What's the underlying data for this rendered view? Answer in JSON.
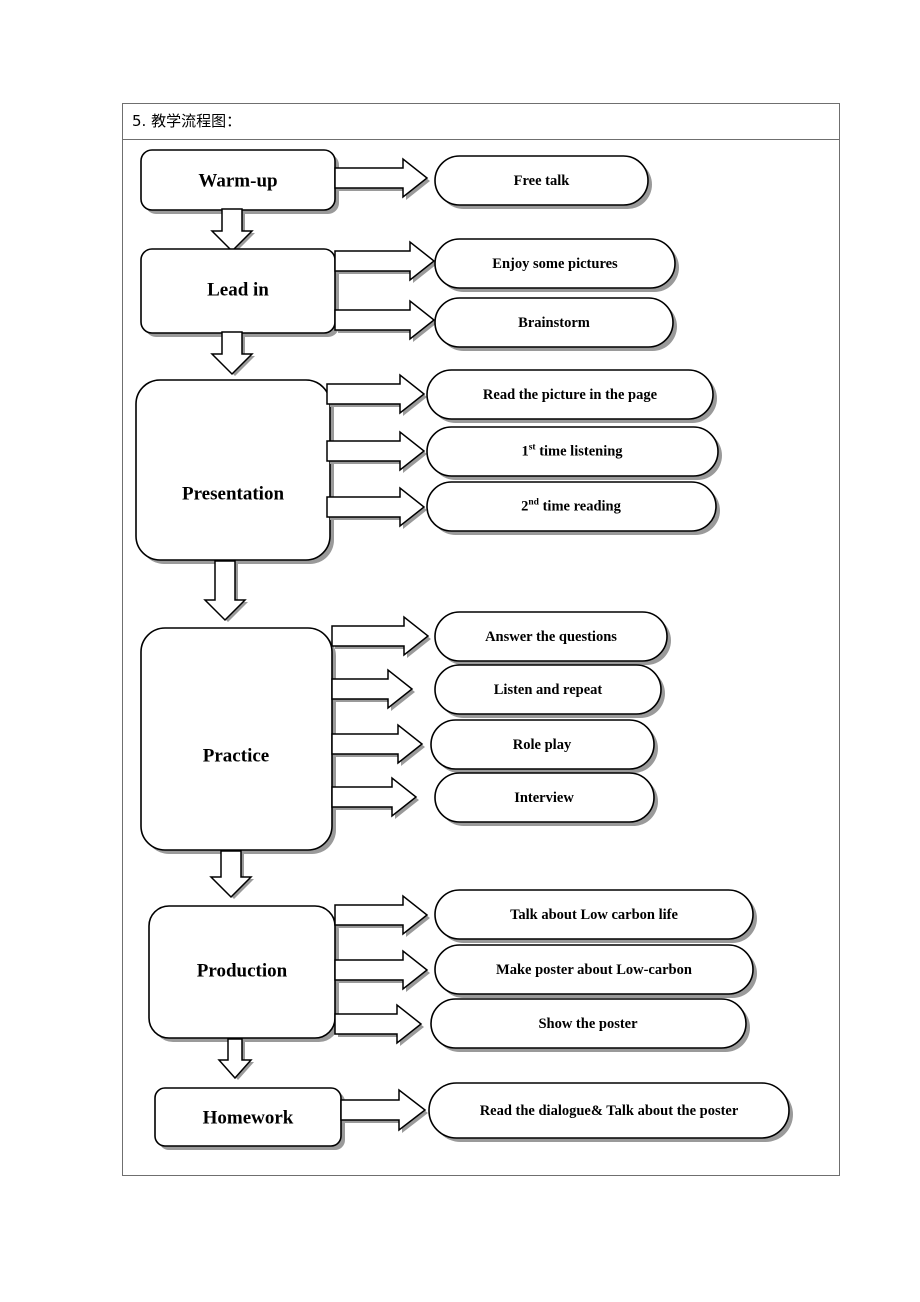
{
  "document": {
    "header_title": "5. 教学流程图："
  },
  "flowchart": {
    "type": "flowchart",
    "orientation": "vertical",
    "stages": [
      {
        "id": "warm-up",
        "label": "Warm-up",
        "details": [
          "Free talk"
        ]
      },
      {
        "id": "lead-in",
        "label": "Lead in",
        "details": [
          "Enjoy some pictures",
          "Brainstorm"
        ]
      },
      {
        "id": "presentation",
        "label": "Presentation",
        "details": [
          "Read the picture in the page",
          "1st time listening",
          "2nd time reading"
        ]
      },
      {
        "id": "practice",
        "label": "Practice",
        "details": [
          "Answer the questions",
          "Listen and repeat",
          "Role play",
          "Interview"
        ]
      },
      {
        "id": "production",
        "label": "Production",
        "details": [
          "Talk about Low carbon life",
          "Make  poster  about  Low-carbon",
          "Show the poster"
        ]
      },
      {
        "id": "homework",
        "label": "Homework",
        "details": [
          "Read the dialogue& Talk about the poster"
        ]
      }
    ],
    "detail_text": {
      "free-talk": "Free talk",
      "enjoy-some-pictures": "Enjoy some pictures",
      "brainstorm": "Brainstorm",
      "read-the-picture": "Read the picture in the page",
      "first-time-listening": {
        "number": "1",
        "ordinal": "st",
        "rest": " time listening"
      },
      "second-time-reading": {
        "number": "2",
        "ordinal": "nd",
        "rest": " time reading"
      },
      "answer-the-questions": "Answer the questions",
      "listen-and-repeat": "Listen and repeat",
      "role-play": "Role play",
      "interview": "Interview",
      "talk-about-low-carbon-life": "Talk about Low carbon life",
      "make-poster": "Make   poster   about   Low-carbon",
      "show-the-poster": "Show the poster",
      "read-dialogue-talk-poster": "Read the dialogue& Talk about the poster"
    },
    "stage_text": {
      "warm-up": "Warm-up",
      "lead-in": "Lead in",
      "presentation": "Presentation",
      "practice": "Practice",
      "production": "Production",
      "homework": "Homework"
    },
    "colors": {
      "stroke": "#000000",
      "fill": "#ffffff",
      "shadow": "#9a9a9a",
      "table_border": "#6f6f6f"
    }
  }
}
